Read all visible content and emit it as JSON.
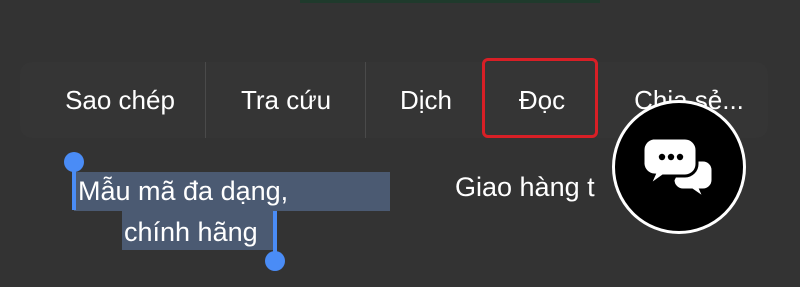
{
  "context_menu": {
    "items": [
      {
        "label": "Sao chép"
      },
      {
        "label": "Tra cứu"
      },
      {
        "label": "Dịch"
      },
      {
        "label": "Đọc"
      },
      {
        "label": "Chia sẻ..."
      }
    ],
    "highlighted_item": "Đọc",
    "highlight_color": "#d81f26"
  },
  "selection": {
    "line1": "Mẫu mã đa dạng,",
    "line2": "chính hãng",
    "handle_color": "#4a8cf6",
    "highlight_color": "#4b5a72"
  },
  "background_text": {
    "delivery": "Giao hàng t"
  },
  "chat_button": {
    "icon": "chat-bubbles-icon"
  }
}
